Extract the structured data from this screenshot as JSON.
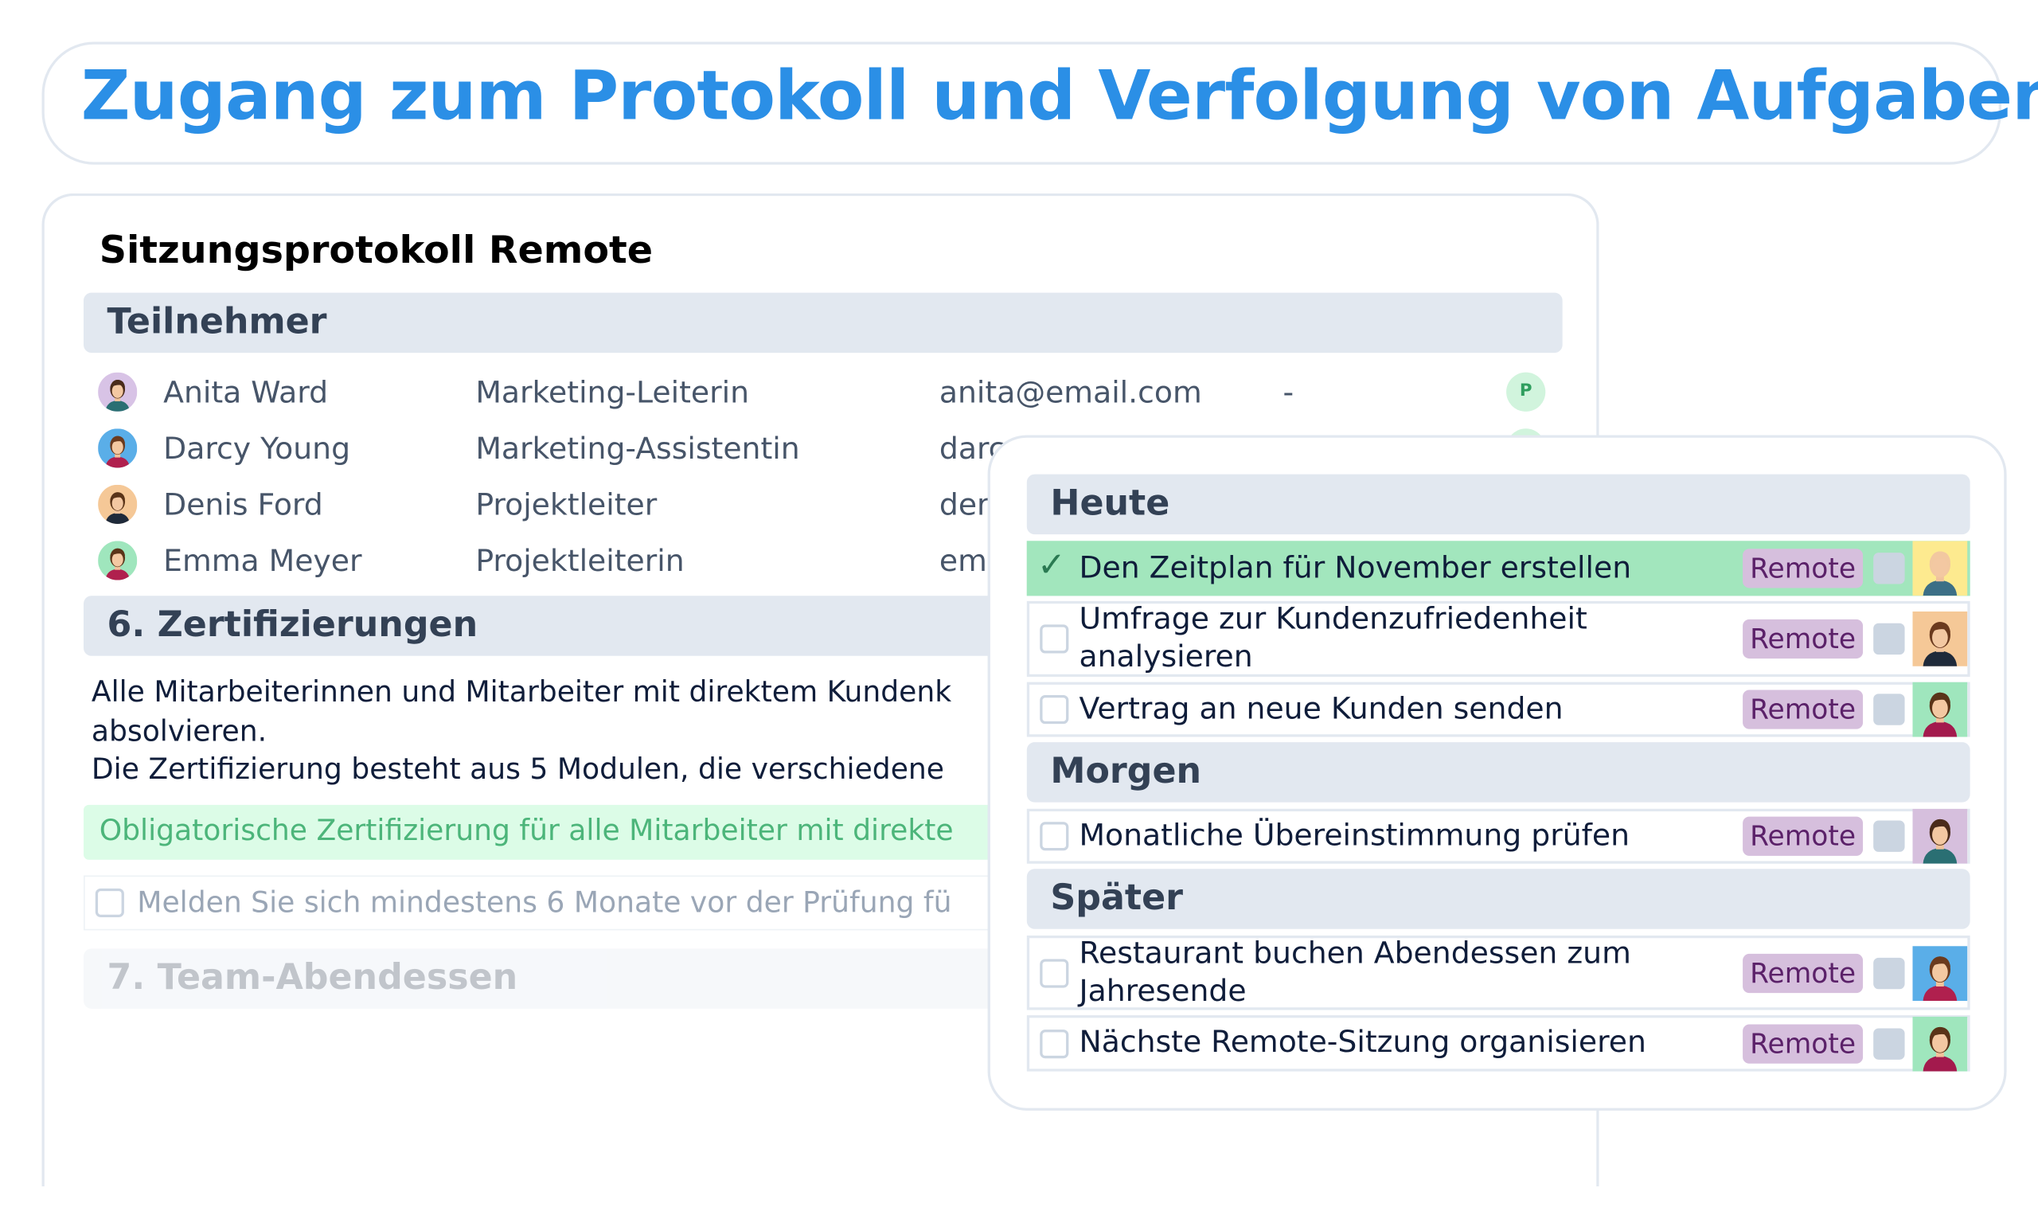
{
  "header": {
    "title": "Zugang zum Protokoll und Verfolgung von Aufgaben",
    "title_color": "#2b8fe6"
  },
  "minutes": {
    "title": "Sitzungsprotokoll Remote",
    "participants_heading": "Teilnehmer",
    "participants": [
      {
        "name": "Anita Ward",
        "role": "Marketing-Leiterin",
        "email": "anita@email.com",
        "extra": "-",
        "badge": "P",
        "avatar_bg": "#d8c3e6",
        "hair": "#4a2b1a",
        "shirt": "#2a6f73"
      },
      {
        "name": "Darcy Young",
        "role": "Marketing-Assistentin",
        "email": "darc",
        "badge": "",
        "avatar_bg": "#5aaee8",
        "hair": "#6b3a1e",
        "shirt": "#b0204e"
      },
      {
        "name": "Denis Ford",
        "role": "Projektleiter",
        "email": "der",
        "badge": "",
        "avatar_bg": "#f5c897",
        "hair": "#5a3418",
        "shirt": "#1f2a3a"
      },
      {
        "name": "Emma Meyer",
        "role": "Projektleiterin",
        "email": "em",
        "badge": "",
        "avatar_bg": "#9fe6bd",
        "hair": "#5a3418",
        "shirt": "#b0204e"
      }
    ],
    "section6_heading": "6. Zertifizierungen",
    "section6_lines": [
      "Alle Mitarbeiterinnen und Mitarbeiter mit direktem Kundenk",
      "absolvieren.",
      "Die Zertifizierung besteht aus 5 Modulen, die verschiedene"
    ],
    "highlight": "Obligatorische Zertifizierung für alle Mitarbeiter mit direkte",
    "todo_item": "Melden Sie sich mindestens 6 Monate vor der Prüfung fü",
    "section7_heading": "7. Team-Abendessen"
  },
  "tasks": {
    "groups": [
      {
        "label": "Heute",
        "items": [
          {
            "text": "Den Zeitplan für November erstellen",
            "done": true,
            "tag": "Remote",
            "avatar_bg": "#fdea8f",
            "hair": "#f2c8a0",
            "shirt": "#3c6f86"
          },
          {
            "text": "Umfrage zur Kundenzufriedenheit analysieren",
            "done": false,
            "tag": "Remote",
            "avatar_bg": "#f5c897",
            "hair": "#6b3a1e",
            "shirt": "#1f2a3a"
          },
          {
            "text": "Vertrag an neue Kunden senden",
            "done": false,
            "tag": "Remote",
            "avatar_bg": "#9fe6bd",
            "hair": "#5a3418",
            "shirt": "#a31a4d"
          }
        ]
      },
      {
        "label": "Morgen",
        "items": [
          {
            "text": "Monatliche Übereinstimmung prüfen",
            "done": false,
            "tag": "Remote",
            "avatar_bg": "#d6bfdd",
            "hair": "#4a2b1a",
            "shirt": "#2a6f73"
          }
        ]
      },
      {
        "label": "Später",
        "items": [
          {
            "text": "Restaurant buchen Abendessen zum Jahresende",
            "done": false,
            "tag": "Remote",
            "avatar_bg": "#5aaee8",
            "hair": "#6b3a1e",
            "shirt": "#b0204e"
          },
          {
            "text": "Nächste Remote-Sitzung organisieren",
            "done": false,
            "tag": "Remote",
            "avatar_bg": "#9fe6bd",
            "hair": "#5a3418",
            "shirt": "#a31a4d"
          }
        ]
      }
    ]
  }
}
